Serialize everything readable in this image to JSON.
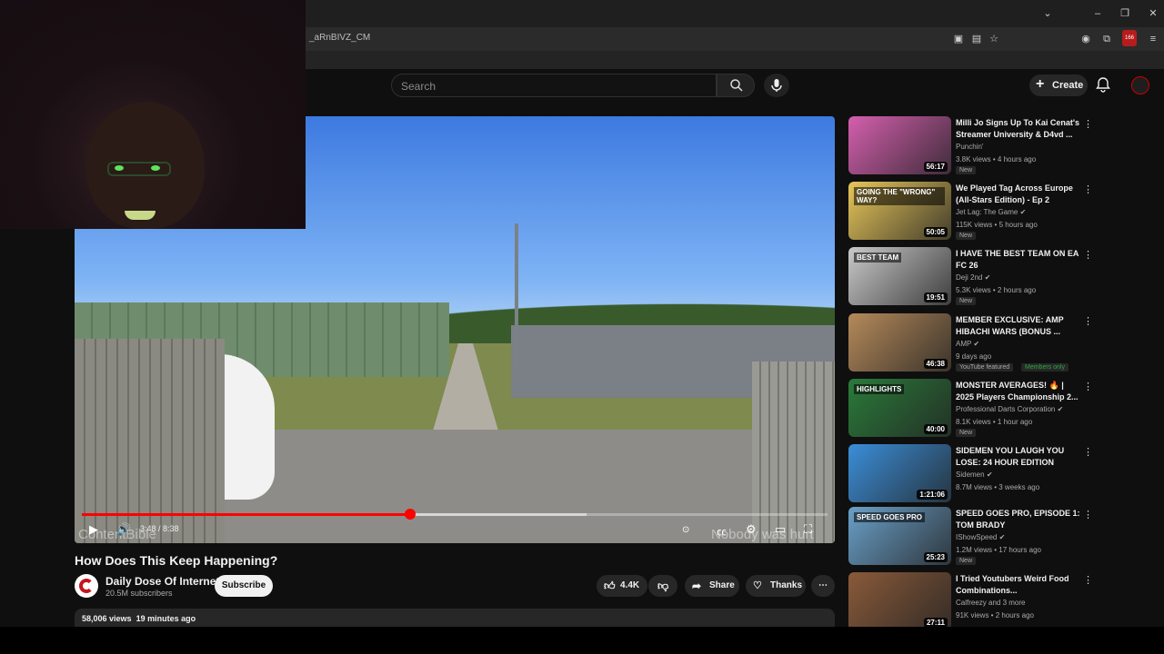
{
  "browser": {
    "url_fragment": "_aRnBIVZ_CM",
    "window_controls": {
      "chevron": "⌄",
      "minimize": "–",
      "restore": "❐",
      "close": "✕"
    },
    "extension_badge": "166"
  },
  "header": {
    "search_placeholder": "Search",
    "create_label": "Create"
  },
  "player": {
    "current_time": "3:48",
    "duration": "8:38",
    "time_display": "3:48 / 8:38",
    "progress_fraction": 0.44,
    "watermark_left": "ContentBible",
    "watermark_right": "Nobody was hurt",
    "icons": [
      "play-icon",
      "volume-icon",
      "autoplay-toggle",
      "captions-icon",
      "settings-icon",
      "theater-icon",
      "fullscreen-icon"
    ]
  },
  "video": {
    "title": "How Does This Keep Happening?",
    "channel": "Daily Dose Of Internet",
    "subscribers": "20.5M subscribers",
    "subscribe_label": "Subscribe",
    "likes": "4.4K",
    "share_label": "Share",
    "thanks_label": "Thanks",
    "views": "58,006 views",
    "posted": "19 minutes ago",
    "brand_color": "#c4161c"
  },
  "recommendations": [
    {
      "title": "Milli Jo Signs Up To Kai Cenat's Streamer University & D4vd ...",
      "channel": "Punchin'",
      "verified": false,
      "meta": "3.8K views • 4 hours ago",
      "duration": "56:17",
      "badge": "New",
      "thumb_color": "#d45fae"
    },
    {
      "title": "We Played Tag Across Europe (All-Stars Edition) - Ep 2",
      "channel": "Jet Lag: The Game",
      "verified": true,
      "meta": "115K views • 5 hours ago",
      "duration": "50:05",
      "badge": "New",
      "thumb_color": "#e7c65a",
      "thumb_text": "GOING THE \"WRONG\" WAY?"
    },
    {
      "title": "I HAVE THE BEST TEAM ON EA FC 26",
      "channel": "Deji 2nd",
      "verified": true,
      "meta": "5.3K views • 2 hours ago",
      "duration": "19:51",
      "badge": "New",
      "thumb_color": "#c9c9c9",
      "thumb_text": "BEST TEAM"
    },
    {
      "title": "MEMBER EXCLUSIVE: AMP HIBACHI WARS (BONUS ...",
      "channel": "AMP",
      "verified": true,
      "meta": "9 days ago",
      "duration": "46:38",
      "badge": "YouTube featured",
      "badge2": "Members only",
      "thumb_color": "#b58a5a"
    },
    {
      "title": "MONSTER AVERAGES! 🔥 | 2025 Players Championship 2...",
      "channel": "Professional Darts Corporation",
      "verified": true,
      "meta": "8.1K views • 1 hour ago",
      "duration": "40:00",
      "badge": "New",
      "thumb_color": "#2a7a3a",
      "thumb_text": "HIGHLIGHTS"
    },
    {
      "title": "SIDEMEN YOU LAUGH YOU LOSE: 24 HOUR EDITION",
      "channel": "Sidemen",
      "verified": true,
      "meta": "8.7M views • 3 weeks ago",
      "duration": "1:21:06",
      "badge": "",
      "thumb_color": "#3b8ed8"
    },
    {
      "title": "SPEED GOES PRO, EPISODE 1: TOM BRADY",
      "channel": "IShowSpeed",
      "verified": true,
      "meta": "1.2M views • 17 hours ago",
      "duration": "25:23",
      "badge": "New",
      "thumb_color": "#6aa0c8",
      "thumb_text": "SPEED GOES PRO"
    },
    {
      "title": "I Tried Youtubers Weird Food Combinations...",
      "channel": "Calfreezy and 3 more",
      "verified": false,
      "meta": "91K views • 2 hours ago",
      "duration": "27:11",
      "badge": "",
      "thumb_color": "#8a5a3a"
    }
  ]
}
